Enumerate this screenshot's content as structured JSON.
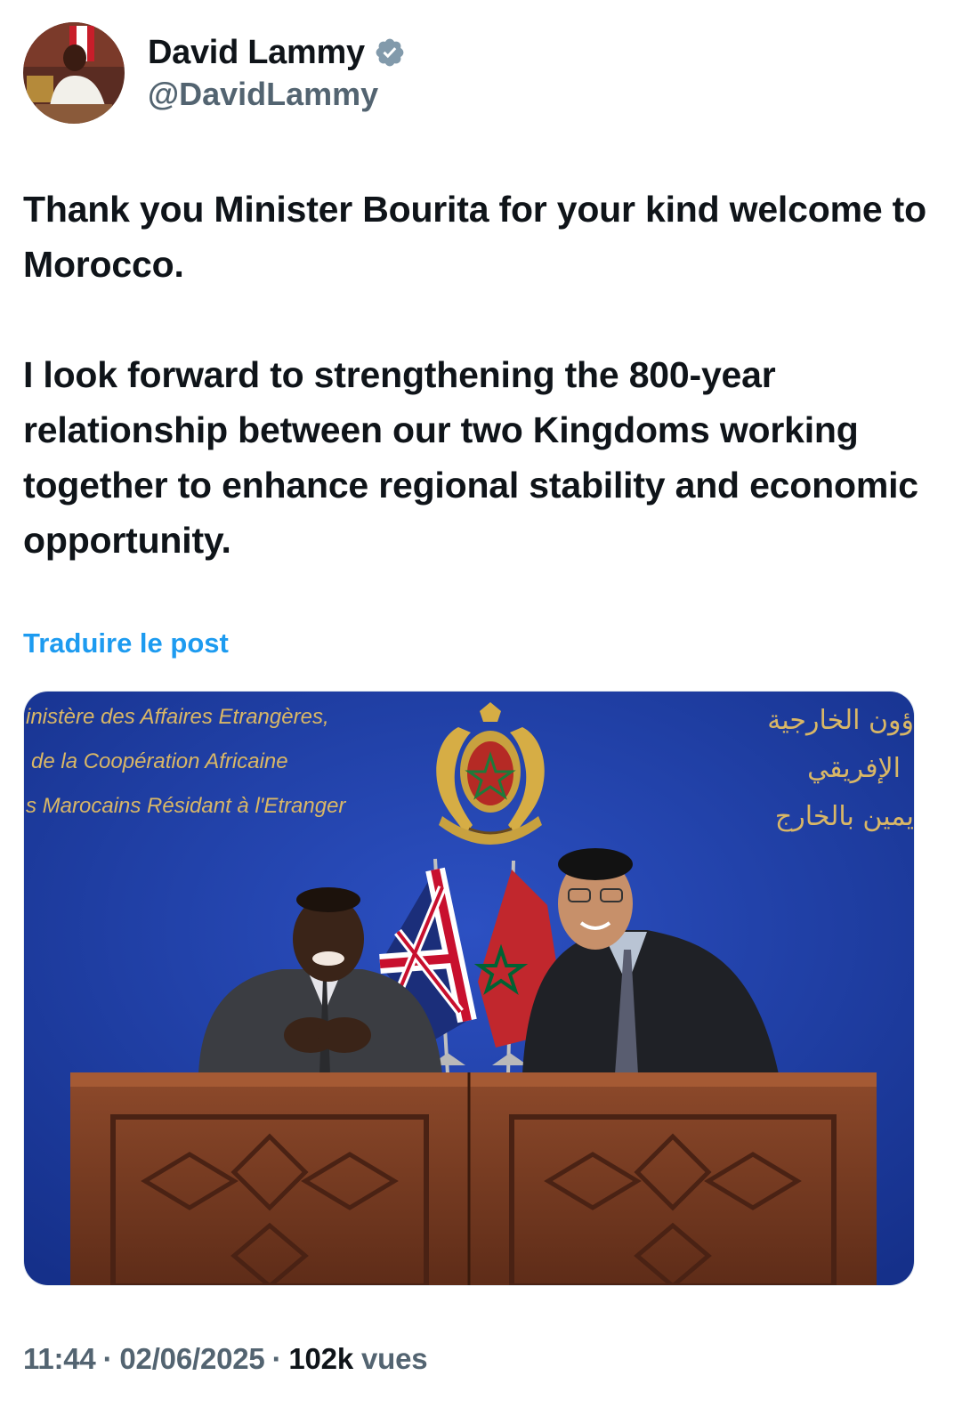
{
  "author": {
    "display_name": "David Lammy",
    "handle": "@DavidLammy",
    "verified_icon": "verified-badge-icon"
  },
  "tweet": {
    "paragraphs": [
      "Thank you Minister Bourita for your kind welcome to Morocco.",
      "I look forward to strengthening the 800-year relationship between our two Kingdoms working together to enhance regional stability and economic opportunity."
    ],
    "translate_label": "Traduire le post"
  },
  "photo": {
    "backdrop_fr_lines": [
      "inistère des Affaires Etrangères,",
      "de la Coopération Africaine",
      "s Marocains Résidant à l'Etranger"
    ],
    "backdrop_ar_lines": [
      "ؤون الخارجية",
      "الإفريقي",
      "يمين بالخارج"
    ],
    "backdrop_color": "#1f3fa8",
    "podium_color": "#7a3a22"
  },
  "meta": {
    "time": "11:44",
    "separator": "·",
    "date": "02/06/2025",
    "views_count": "102k",
    "views_label": "vues"
  },
  "colors": {
    "link_blue": "#1d9bf0",
    "secondary_text": "#536471",
    "primary_text": "#0f1419",
    "verified_fill": "#829aab"
  }
}
